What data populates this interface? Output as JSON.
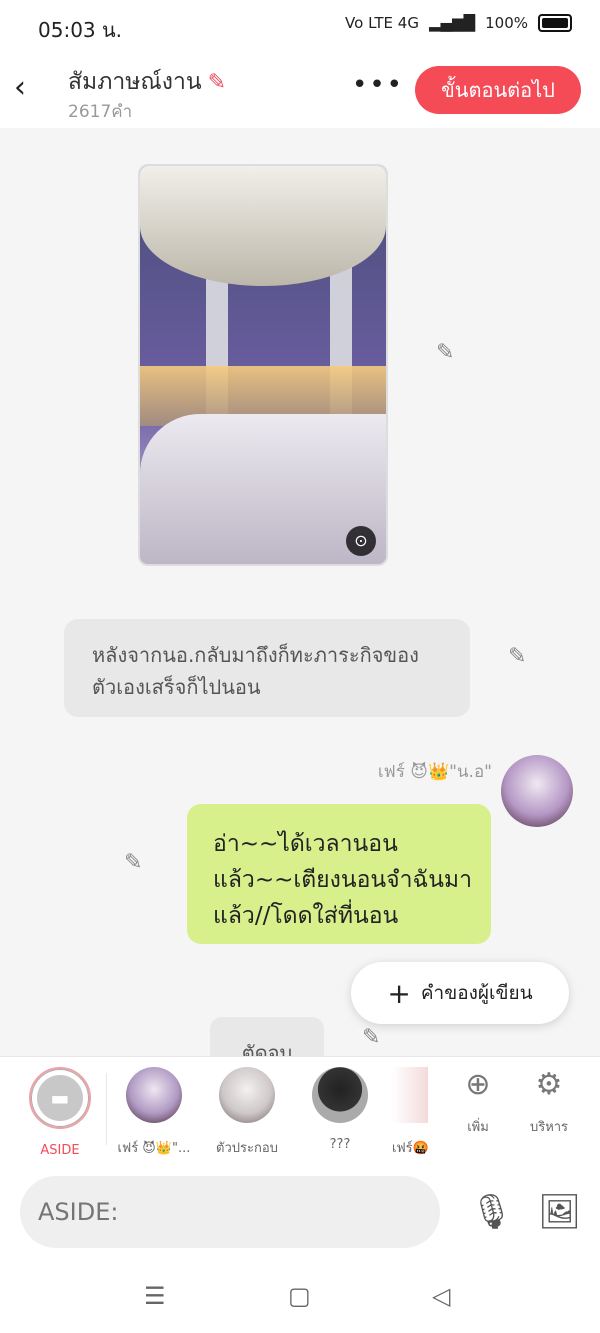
{
  "status": {
    "time": "05:03 น.",
    "network": "Vo LTE 4G",
    "battery": "100%"
  },
  "header": {
    "title": "สัมภาษณ์งาน",
    "word_count": "2617คำ",
    "more": "•••",
    "next_button": "ขั้นตอนต่อไป"
  },
  "chat": {
    "aside_text": "หลังจากนอ.กลับมาถึงก็ทะภาระกิจของตัวเองเสร็จก็ไปนอน",
    "character_name": "เฟร์ 😈👑\"น.อ\"",
    "message": "อ่า~~ได้เวลานอนแล้ว~~เตียงนอนจำฉันมาแล้ว//โดดใส่ที่นอน",
    "writer_button": "คำของผู้เขียน",
    "partial_bubble": "ตัดจบ"
  },
  "charbar": {
    "items": [
      {
        "label": "ASIDE",
        "color": "#f54b57"
      },
      {
        "label": "เฟร์ 😈👑\"..."
      },
      {
        "label": "ตัวประกอบ"
      },
      {
        "label": "???"
      },
      {
        "label": "เฟร์🤬"
      },
      {
        "label": "เพิ่ม"
      },
      {
        "label": "บริหาร"
      }
    ]
  },
  "input": {
    "placeholder": "ASIDE:"
  },
  "icons": {
    "back": "back-chevron-icon",
    "pencil": "edit-pencil-icon",
    "zoom": "zoom-scan-icon",
    "mic": "microphone-icon",
    "image": "image-icon",
    "add": "add-circle-icon",
    "settings": "gear-icon",
    "menu": "menu-icon",
    "home": "home-square-icon",
    "navback": "back-triangle-icon"
  }
}
